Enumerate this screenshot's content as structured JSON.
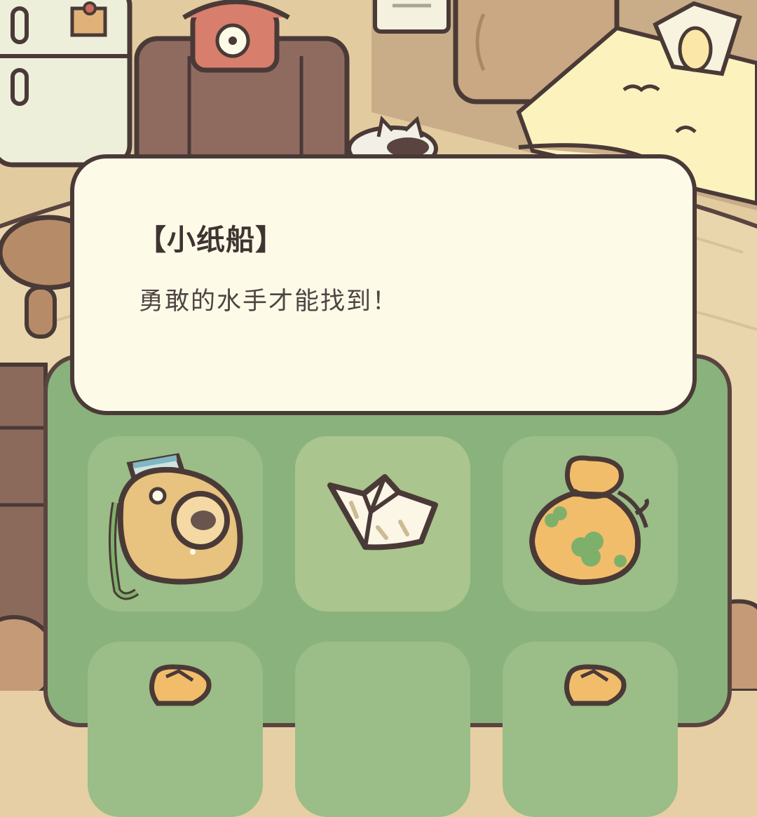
{
  "tooltip": {
    "title": "【小纸船】",
    "description": "勇敢的水手才能找到！"
  },
  "inventory": {
    "slots": [
      {
        "item": "instant-camera-icon",
        "selected": false
      },
      {
        "item": "paper-boat-icon",
        "selected": true
      },
      {
        "item": "clover-pouch-icon",
        "selected": false
      },
      {
        "item": "pouch-icon",
        "selected": false
      },
      {
        "item": "empty",
        "selected": false
      },
      {
        "item": "pouch-icon",
        "selected": false
      }
    ]
  },
  "colors": {
    "panel": "#8ab27c",
    "slot": "#9bbd88",
    "slot_selected": "#aac58d",
    "tooltip_bg": "#fdfbe8",
    "outline": "#4a3a37"
  }
}
